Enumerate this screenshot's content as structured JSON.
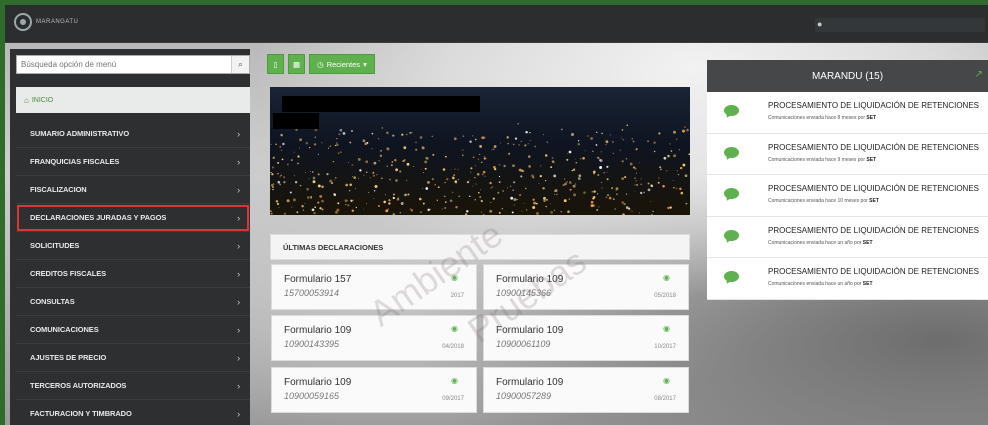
{
  "app": {
    "logo_text": "MARANGATU"
  },
  "sidebar": {
    "search_placeholder": "Búsqueda opción de menú",
    "inicio_label": "INICIO",
    "items": [
      {
        "label": "SUMARIO ADMINISTRATIVO"
      },
      {
        "label": "FRANQUICIAS FISCALES"
      },
      {
        "label": "FISCALIZACION"
      },
      {
        "label": "DECLARACIONES JURADAS Y PAGOS"
      },
      {
        "label": "SOLICITUDES"
      },
      {
        "label": "CREDITOS FISCALES"
      },
      {
        "label": "CONSULTAS"
      },
      {
        "label": "COMUNICACIONES"
      },
      {
        "label": "AJUSTES DE PRECIO"
      },
      {
        "label": "TERCEROS AUTORIZADOS"
      },
      {
        "label": "FACTURACION Y TIMBRADO"
      }
    ]
  },
  "toolbar": {
    "recent_label": "Recientes"
  },
  "declarations": {
    "header": "ÚLTIMAS DECLARACIONES",
    "cards": [
      {
        "title": "Formulario 157",
        "number": "15700053914",
        "date": "2017"
      },
      {
        "title": "Formulario 109",
        "number": "10900145366",
        "date": "05/2018"
      },
      {
        "title": "Formulario 109",
        "number": "10900143395",
        "date": "04/2018"
      },
      {
        "title": "Formulario 109",
        "number": "10900061109",
        "date": "10/2017"
      },
      {
        "title": "Formulario 109",
        "number": "10900059165",
        "date": "09/2017"
      },
      {
        "title": "Formulario 109",
        "number": "10900057289",
        "date": "08/2017"
      }
    ]
  },
  "notifications": {
    "header": "MARANDU (15)",
    "items": [
      {
        "title": "PROCESAMIENTO DE LIQUIDACIÓN DE RETENCIONES",
        "subtitle": "Comunicaciones enviada hace 8 meses por",
        "sender": "SET"
      },
      {
        "title": "PROCESAMIENTO DE LIQUIDACIÓN DE RETENCIONES",
        "subtitle": "Comunicaciones enviada hace 9 meses por",
        "sender": "SET"
      },
      {
        "title": "PROCESAMIENTO DE LIQUIDACIÓN DE RETENCIONES",
        "subtitle": "Comunicaciones enviada hace 10 meses por",
        "sender": "SET"
      },
      {
        "title": "PROCESAMIENTO DE LIQUIDACIÓN DE RETENCIONES",
        "subtitle": "Comunicaciones enviada hace un año por",
        "sender": "SET"
      },
      {
        "title": "PROCESAMIENTO DE LIQUIDACIÓN DE RETENCIONES",
        "subtitle": "Comunicaciones enviada hace un año por",
        "sender": "SET"
      }
    ]
  },
  "watermark": {
    "line1": "Ambiente",
    "line2": "Pruebas"
  },
  "colors": {
    "accent": "#5fb14e",
    "sidebar": "#2d2f31",
    "highlight": "#d9353a"
  }
}
